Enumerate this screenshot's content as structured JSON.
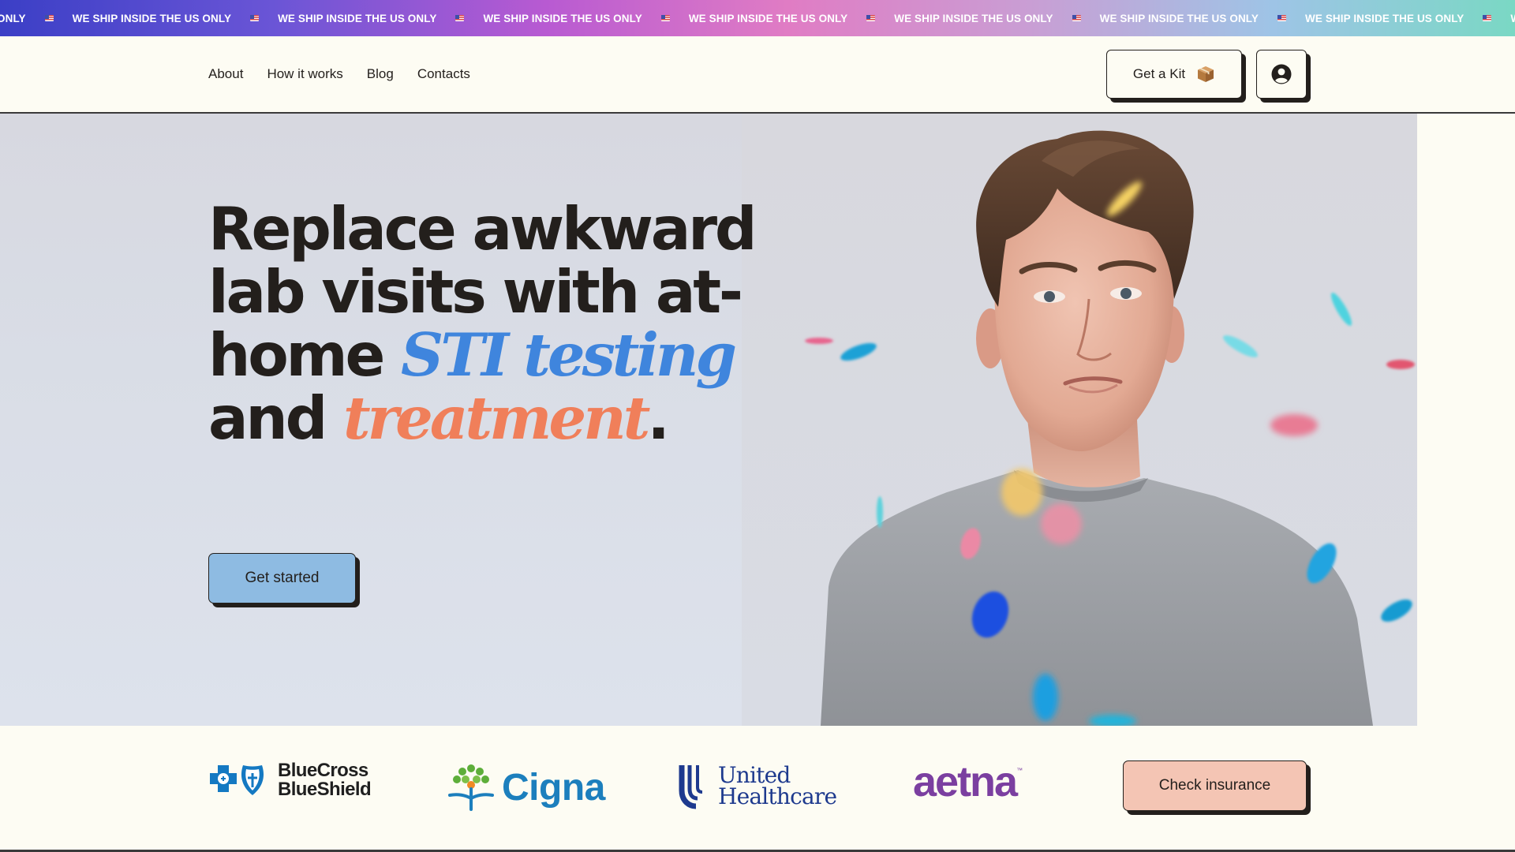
{
  "banner": {
    "leading_text": "ONLY",
    "repeat_text": "WE SHIP INSIDE THE US ONLY",
    "trailing_text": "WE SHIP I",
    "flag_icon": "us-flag-icon"
  },
  "nav": {
    "links": [
      "About",
      "How it works",
      "Blog",
      "Contacts"
    ]
  },
  "header": {
    "kit_button": "Get a Kit",
    "kit_icon": "package-box-icon",
    "account_icon": "user-circle-icon"
  },
  "hero": {
    "headline_part1": "Replace awkward lab visits with at-home ",
    "headline_blue": "STI testing",
    "headline_mid": " and ",
    "headline_orange": "treatment",
    "headline_end": ".",
    "cta_label": "Get started",
    "colors": {
      "blue": "#3f85dd",
      "orange": "#f07f5a",
      "cta_bg": "#8ebbe2"
    }
  },
  "insurers": {
    "bcbs_line1": "BlueCross",
    "bcbs_line2": "BlueShield",
    "cigna": "Cigna",
    "uhc_line1": "United",
    "uhc_line2": "Healthcare",
    "aetna": "aetna",
    "aetna_tm": "™",
    "check_button": "Check insurance",
    "colors": {
      "check_bg": "#f4c5b4"
    }
  }
}
